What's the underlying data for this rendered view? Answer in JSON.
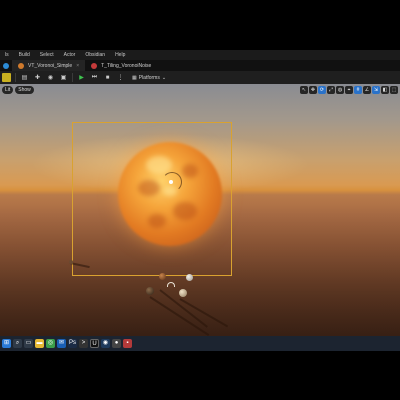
{
  "menu": {
    "items": [
      "ls",
      "Build",
      "Select",
      "Actor",
      "Obsidian",
      "Help"
    ]
  },
  "tabs": [
    {
      "label": "VT_Voronoi_Simple",
      "icon": "material-icon",
      "active": true
    },
    {
      "label": "T_Tiling_VoronoiNoise",
      "icon": "texture-icon",
      "active": false
    }
  ],
  "toolbar": {
    "platforms_label": "Platforms",
    "play_icon": "play-icon"
  },
  "viewport": {
    "left_pills": [
      "Lit",
      "Show"
    ],
    "right_icons": [
      "select-mode-icon",
      "translate-icon",
      "rotate-icon",
      "scale-icon",
      "world-icon",
      "snap-icon",
      "grid-icon",
      "angle-icon",
      "scale-snap-icon",
      "camera-speed-icon",
      "maximize-icon"
    ],
    "active_right_icon": 2
  },
  "colors": {
    "selection_box": "#d9a230",
    "sun_core": "#ffd26a",
    "sun_edge": "#c45a1a",
    "play_green": "#3fc34f",
    "taskbar_bg": "#1c2430"
  },
  "taskbar": {
    "icons": [
      "windows-start-icon",
      "search-icon",
      "task-view-icon",
      "explorer-icon",
      "chrome-icon",
      "mail-icon",
      "photoshop-icon",
      "terminal-icon",
      "unreal-icon",
      "steam-icon",
      "obs-icon",
      "app-icon"
    ]
  }
}
